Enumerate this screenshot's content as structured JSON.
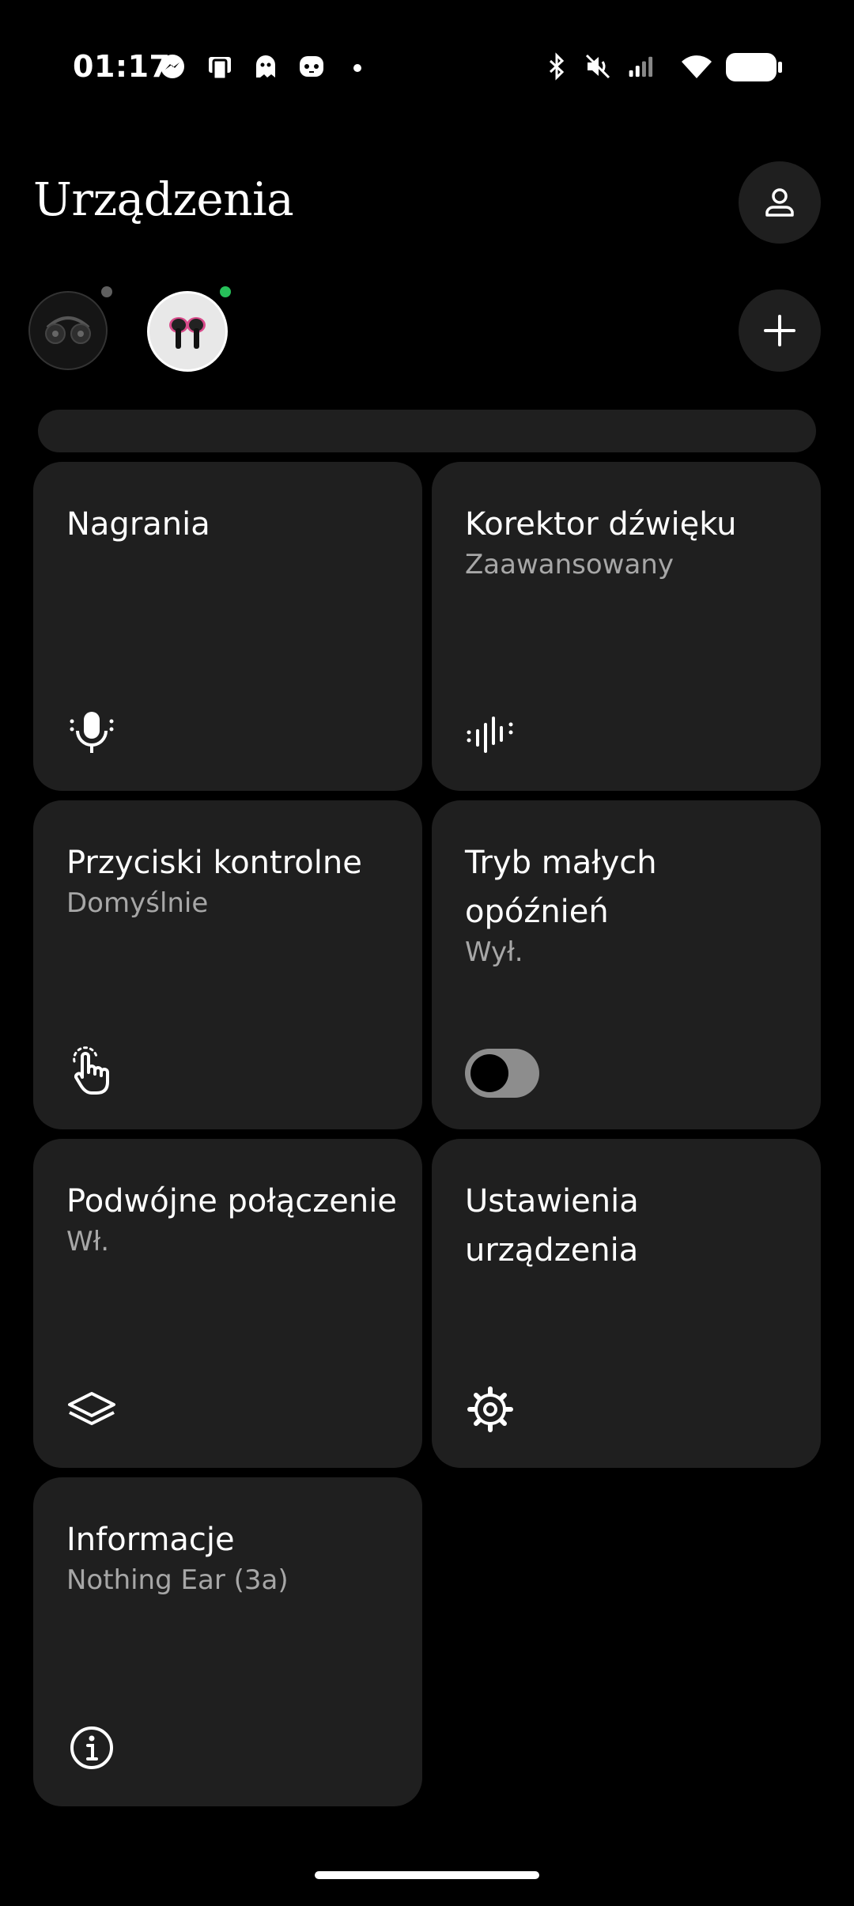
{
  "status_bar": {
    "time": "01:17",
    "left_icons": [
      "messenger-icon",
      "app-notification-icon",
      "ghost-icon",
      "game-icon",
      "dot-icon"
    ],
    "right_icons": [
      "bluetooth-icon",
      "mute-icon",
      "signal-icon",
      "wifi-icon",
      "battery-icon"
    ]
  },
  "header": {
    "title": "Urządzenia",
    "profile_icon": "person-icon",
    "add_icon": "plus-icon"
  },
  "devices": [
    {
      "name": "nothing-headphones",
      "status_color": "#5f5f5f",
      "selected": false
    },
    {
      "name": "nothing-ear-3a",
      "status_color": "#27c15a",
      "selected": true
    }
  ],
  "tiles": [
    {
      "title": "Nagrania",
      "subtitle": "",
      "icon": "microphone-icon"
    },
    {
      "title": "Korektor dźwięku",
      "subtitle": "Zaawansowany",
      "icon": "equalizer-icon"
    },
    {
      "title": "Przyciski kontrolne",
      "subtitle": "Domyślnie",
      "icon": "touch-gesture-icon"
    },
    {
      "title": "Tryb małych opóźnień",
      "subtitle": "Wył.",
      "icon": "toggle-switch",
      "toggle_on": false
    },
    {
      "title": "Podwójne połączenie",
      "subtitle": "Wł.",
      "icon": "layers-icon"
    },
    {
      "title": "Ustawienia urządzenia",
      "subtitle": "",
      "icon": "gear-icon"
    },
    {
      "title": "Informacje",
      "subtitle": "Nothing Ear (3a)",
      "icon": "info-icon"
    }
  ],
  "colors": {
    "background": "#000000",
    "tile": "#1f1f1f",
    "subtitle": "#a7a7a7",
    "connected": "#27c15a"
  }
}
